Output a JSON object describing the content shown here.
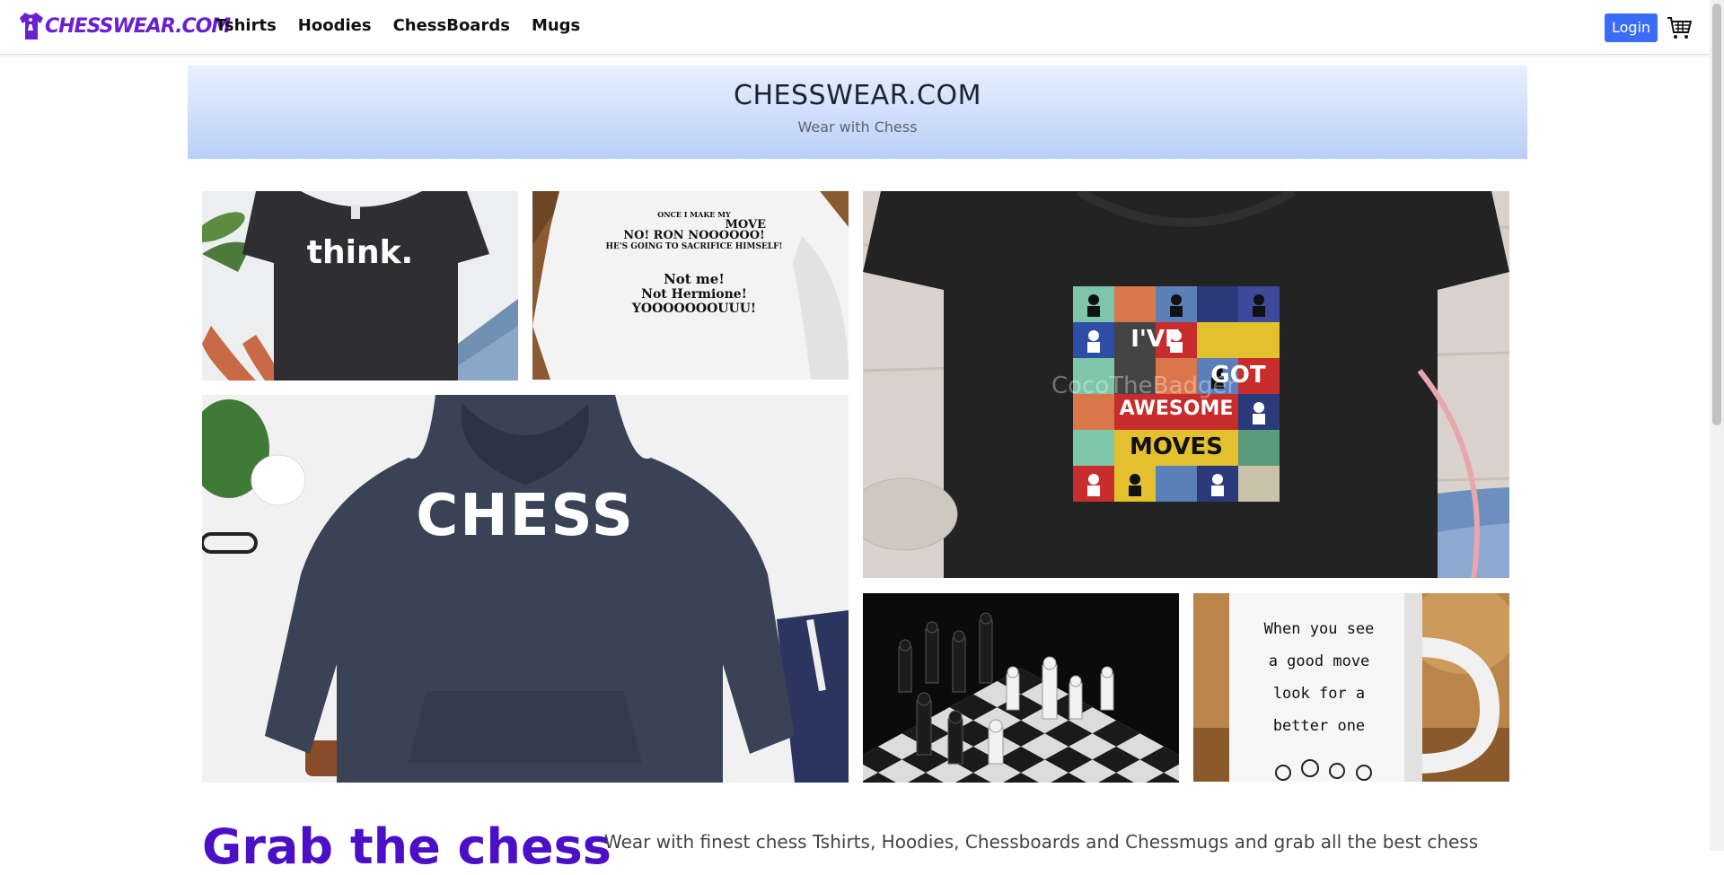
{
  "navbar": {
    "logo_text": "CHESSWEAR.COM",
    "links": [
      "Tshirts",
      "Hoodies",
      "ChessBoards",
      "Mugs"
    ],
    "login_label": "Login",
    "cart_icon": "cart-icon"
  },
  "hero": {
    "title": "CHESSWEAR.COM",
    "subtitle": "Wear with Chess"
  },
  "gallery": {
    "think_tshirt": {
      "print": "think."
    },
    "hp_hoodie": {
      "lines": [
        "ONCE I MAKE MY",
        "MOVE",
        "NO! RON NOOOOOO!",
        "HE'S GOING TO SACRIFICE HIMSELF!",
        "Not me!",
        "Not Hermione!",
        "YOOOOOOOUUU!"
      ]
    },
    "awesome_tshirt": {
      "lines": [
        "I'VE",
        "GOT",
        "AWESOME",
        "MOVES"
      ],
      "watermark": "CocoTheBadger"
    },
    "chess_hoodie": {
      "print": "CHESS"
    },
    "chessboard": {},
    "mug": {
      "lines": [
        "When you see",
        "a good move",
        "look for a",
        "better one"
      ]
    }
  },
  "intro": {
    "heading": "Grab the chess",
    "text": "Wear with finest chess Tshirts, Hoodies, Chessboards and Chessmugs and grab all the best chess"
  },
  "colors": {
    "brand": "#6a1fd1",
    "login": "#3b6cf6",
    "heading": "#4b0fc7"
  }
}
